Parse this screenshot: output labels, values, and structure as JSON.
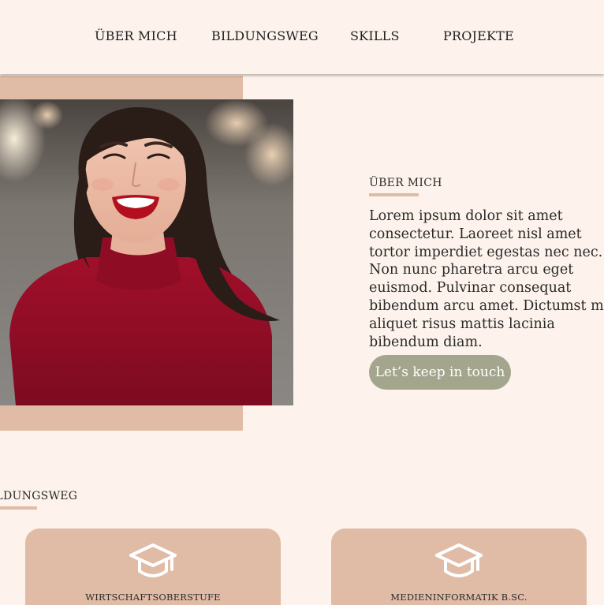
{
  "nav": {
    "items": [
      {
        "label": "ÜBER MICH"
      },
      {
        "label": "BILDUNGSWEG"
      },
      {
        "label": "SKILLS"
      },
      {
        "label": "PROJEKTE"
      }
    ]
  },
  "about": {
    "heading": "ÜBER MICH",
    "text": "Lorem ipsum dolor sit amet consectetur. Laoreet nisl amet tortor imperdiet egestas nec nec. Non nunc pharetra arcu eget euismod. Pulvinar consequat bibendum arcu amet. Dictumst mi aliquet risus mattis lacinia bibendum diam.",
    "cta_label": "Let’s keep in touch"
  },
  "education": {
    "heading": "BILDUNGSWEG",
    "cards": [
      {
        "title": "WIRTSCHAFTSOBERSTUFE",
        "icon": "graduation-cap-icon"
      },
      {
        "title": "MEDIENINFORMATIK B.SC.",
        "icon": "graduation-cap-icon"
      }
    ]
  },
  "colors": {
    "background": "#fdf3ec",
    "accent": "#e0bba6",
    "button": "#a3a58c"
  }
}
